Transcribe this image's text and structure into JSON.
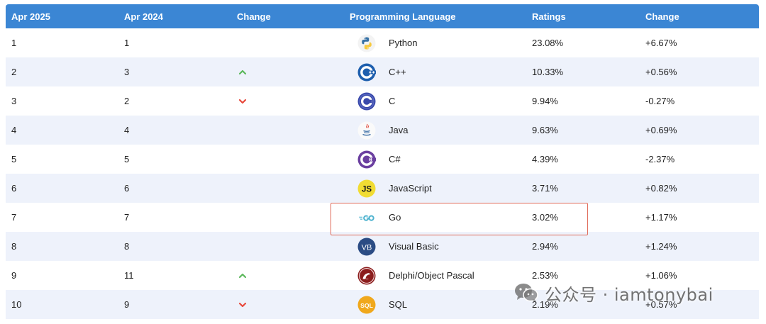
{
  "table": {
    "headers": {
      "rank_now": "Apr 2025",
      "rank_prev": "Apr 2024",
      "change": "Change",
      "language": "Programming Language",
      "ratings": "Ratings",
      "ratings_change": "Change"
    },
    "rows": [
      {
        "rank_now": "1",
        "rank_prev": "1",
        "trend": "none",
        "logo": "python-logo-icon",
        "language": "Python",
        "ratings": "23.08%",
        "change": "+6.67%"
      },
      {
        "rank_now": "2",
        "rank_prev": "3",
        "trend": "up",
        "logo": "cpp-logo-icon",
        "language": "C++",
        "ratings": "10.33%",
        "change": "+0.56%"
      },
      {
        "rank_now": "3",
        "rank_prev": "2",
        "trend": "down",
        "logo": "c-logo-icon",
        "language": "C",
        "ratings": "9.94%",
        "change": "-0.27%"
      },
      {
        "rank_now": "4",
        "rank_prev": "4",
        "trend": "none",
        "logo": "java-logo-icon",
        "language": "Java",
        "ratings": "9.63%",
        "change": "+0.69%"
      },
      {
        "rank_now": "5",
        "rank_prev": "5",
        "trend": "none",
        "logo": "csharp-logo-icon",
        "language": "C#",
        "ratings": "4.39%",
        "change": "-2.37%"
      },
      {
        "rank_now": "6",
        "rank_prev": "6",
        "trend": "none",
        "logo": "javascript-logo-icon",
        "language": "JavaScript",
        "ratings": "3.71%",
        "change": "+0.82%"
      },
      {
        "rank_now": "7",
        "rank_prev": "7",
        "trend": "none",
        "logo": "go-logo-icon",
        "language": "Go",
        "ratings": "3.02%",
        "change": "+1.17%"
      },
      {
        "rank_now": "8",
        "rank_prev": "8",
        "trend": "none",
        "logo": "visual-basic-logo-icon",
        "language": "Visual Basic",
        "ratings": "2.94%",
        "change": "+1.24%"
      },
      {
        "rank_now": "9",
        "rank_prev": "11",
        "trend": "up",
        "logo": "delphi-logo-icon",
        "language": "Delphi/Object Pascal",
        "ratings": "2.53%",
        "change": "+1.06%"
      },
      {
        "rank_now": "10",
        "rank_prev": "9",
        "trend": "down",
        "logo": "sql-logo-icon",
        "language": "SQL",
        "ratings": "2.19%",
        "change": "+0.57%"
      }
    ]
  },
  "highlight": {
    "row": "Go",
    "color": "#e06b5a"
  },
  "watermark": {
    "text": "公众号 · iamtonybai",
    "icon": "wechat-icon"
  },
  "colors": {
    "header_bg": "#3b86d4",
    "row_alt_bg": "#eef2fb",
    "trend_up": "#5cb85c",
    "trend_down": "#e8493c"
  }
}
